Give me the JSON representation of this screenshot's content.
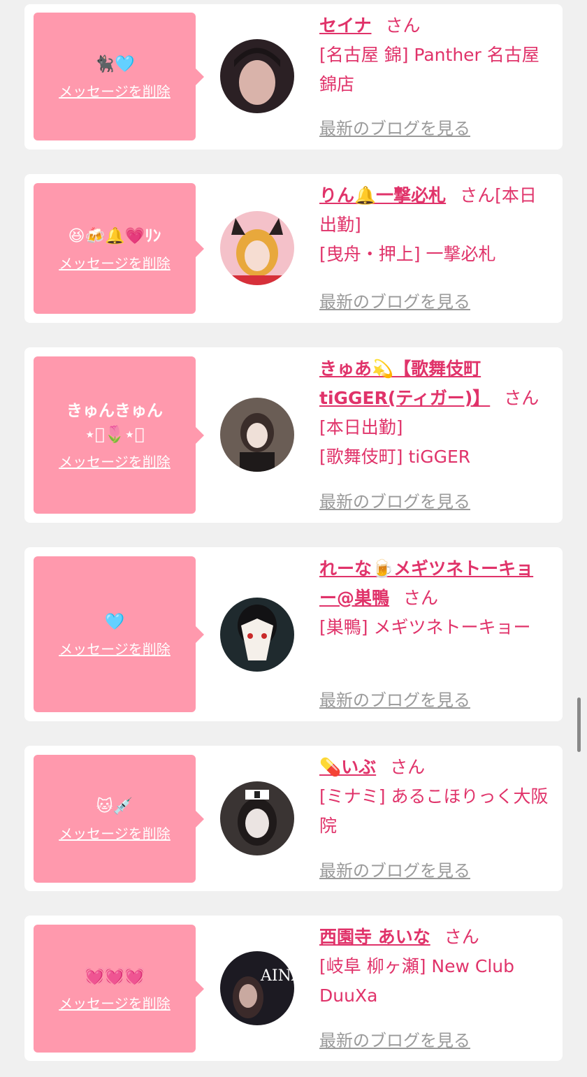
{
  "cards": [
    {
      "message": "🐈‍⬛🩵",
      "delete_label": "メッセージを削除",
      "name": "セイナ",
      "honorific": "さん",
      "shop": "[名古屋 錦] Panther 名古屋錦店",
      "blog_label": "最新のブログを見る",
      "avatar_colors": [
        "#2b2024",
        "#d9b3aa"
      ]
    },
    {
      "message": "😆🍻🔔💗ﾘﾝ",
      "delete_label": "メッセージを削除",
      "name": "りん🔔一撃必札",
      "honorific": "さん[本日出勤]",
      "shop": "[曳舟・押上] 一撃必札",
      "blog_label": "最新のブログを見る",
      "avatar_colors": [
        "#f4c1c9",
        "#e8a83c"
      ]
    },
    {
      "message": "きゅんきゅん\n⋆͛🌷⋆͛",
      "delete_label": "メッセージを削除",
      "name": "きゅあ💫【歌舞伎町tiGGER(ティガー)】",
      "honorific": "さん[本日出勤]",
      "shop": "[歌舞伎町] tiGGER",
      "blog_label": "最新のブログを見る",
      "avatar_colors": [
        "#6a5d55",
        "#efe0d8"
      ]
    },
    {
      "message": "🩵",
      "delete_label": "メッセージを削除",
      "name": "れーな🍺メギツネトーキョー@巣鴨",
      "honorific": "さん",
      "shop": "[巣鴨] メギツネトーキョー",
      "blog_label": "最新のブログを見る",
      "avatar_colors": [
        "#1f2a2e",
        "#f5f0ea"
      ]
    },
    {
      "message": "🐱💉",
      "delete_label": "メッセージを削除",
      "name": "💊いぶ",
      "honorific": "さん",
      "shop": "[ミナミ] あるこほりっく大阪院",
      "blog_label": "最新のブログを見る",
      "avatar_colors": [
        "#3a3433",
        "#ebe4e2"
      ]
    },
    {
      "message": "💓💓💓",
      "delete_label": "メッセージを削除",
      "name": "西園寺 あいな",
      "honorific": "さん",
      "shop": "[岐阜 柳ヶ瀬] New Club DuuXa",
      "blog_label": "最新のブログを見る",
      "avatar_colors": [
        "#1c1a22",
        "#c9a9a0"
      ],
      "avatar_text": "AINA"
    }
  ]
}
